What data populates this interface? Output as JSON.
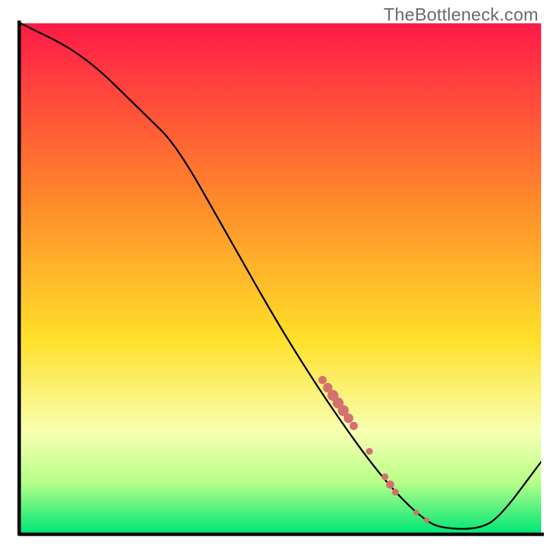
{
  "watermark": "TheBottleneck.com",
  "colors": {
    "gradient_top": "#ff1a48",
    "gradient_mid1": "#ff8a2a",
    "gradient_mid2": "#ffe02a",
    "gradient_band_light": "#f8ffb0",
    "gradient_band_green1": "#b8ff8a",
    "gradient_bottom": "#00e676",
    "axis": "#000000",
    "curve": "#000000",
    "marker": "#d47070"
  },
  "chart_data": {
    "type": "line",
    "title": "",
    "xlabel": "",
    "ylabel": "",
    "xlim": [
      0,
      100
    ],
    "ylim": [
      0,
      100
    ],
    "curve": [
      {
        "x": 0,
        "y": 100
      },
      {
        "x": 12,
        "y": 94
      },
      {
        "x": 24,
        "y": 82
      },
      {
        "x": 30,
        "y": 76
      },
      {
        "x": 40,
        "y": 58
      },
      {
        "x": 50,
        "y": 40
      },
      {
        "x": 60,
        "y": 24
      },
      {
        "x": 70,
        "y": 10
      },
      {
        "x": 78,
        "y": 2
      },
      {
        "x": 82,
        "y": 0.8
      },
      {
        "x": 88,
        "y": 0.8
      },
      {
        "x": 92,
        "y": 3
      },
      {
        "x": 100,
        "y": 14
      }
    ],
    "markers": [
      {
        "x": 58,
        "y": 30,
        "r": 6
      },
      {
        "x": 59,
        "y": 28.5,
        "r": 7
      },
      {
        "x": 60,
        "y": 27,
        "r": 8
      },
      {
        "x": 61,
        "y": 25.5,
        "r": 8
      },
      {
        "x": 62,
        "y": 24,
        "r": 8
      },
      {
        "x": 63,
        "y": 22.5,
        "r": 7
      },
      {
        "x": 64,
        "y": 21,
        "r": 6
      },
      {
        "x": 67,
        "y": 16,
        "r": 5
      },
      {
        "x": 70,
        "y": 11,
        "r": 5
      },
      {
        "x": 71,
        "y": 9.5,
        "r": 6
      },
      {
        "x": 72,
        "y": 8,
        "r": 5
      },
      {
        "x": 76,
        "y": 4,
        "r": 4
      },
      {
        "x": 78,
        "y": 2.5,
        "r": 4
      }
    ]
  }
}
